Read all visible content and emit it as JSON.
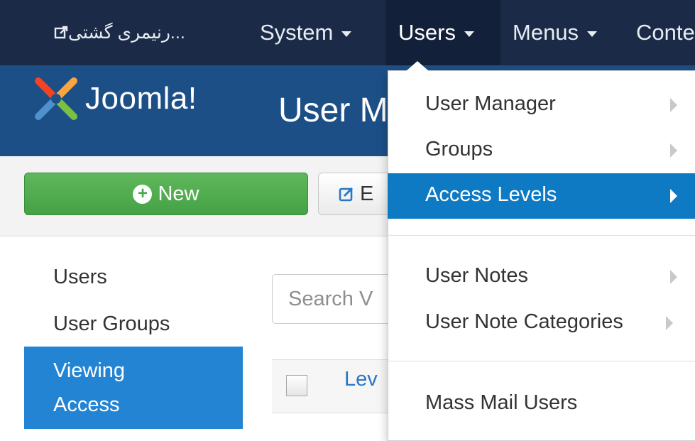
{
  "navbar": {
    "site_label": "...رنیمری گشتی",
    "system_label": "System",
    "users_label": "Users",
    "menus_label": "Menus",
    "content_label": "Conte"
  },
  "header": {
    "logo_text": "Joomla!",
    "page_title": "User M"
  },
  "toolbar": {
    "new_label": "New",
    "edit_label": "E"
  },
  "sidebar": {
    "items": [
      {
        "label": "Users"
      },
      {
        "label": "User Groups"
      },
      {
        "label_line1": "Viewing",
        "label_line2": "Access"
      }
    ]
  },
  "search": {
    "placeholder": "Search V"
  },
  "table": {
    "column_level": "Lev"
  },
  "users_menu": {
    "items": [
      {
        "label": "User Manager"
      },
      {
        "label": "Groups"
      },
      {
        "label": "Access Levels"
      },
      {
        "label": "User Notes"
      },
      {
        "label": "User Note Categories"
      },
      {
        "label": "Mass Mail Users"
      }
    ],
    "active_index": 2
  },
  "colors": {
    "navbar_bg": "#1b2b47",
    "header_bg": "#1d4f87",
    "menu_active_bg": "#0f7ac4",
    "sidebar_active_bg": "#2384d3",
    "new_button_bg": "#4aa649"
  }
}
